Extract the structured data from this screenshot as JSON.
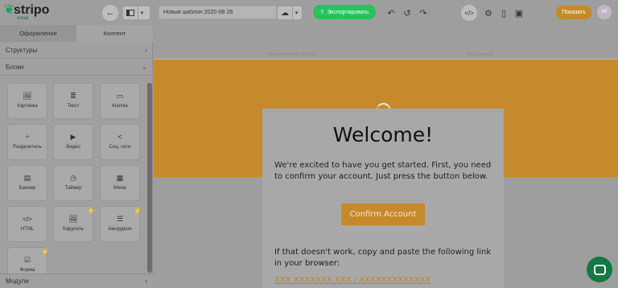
{
  "app": {
    "logo_text": "stripo",
    "logo_sub": "email"
  },
  "toolbar": {
    "back_icon": "arrow-left-icon",
    "template_name": "Новый шаблон 2020-08-26",
    "export_label": "Экспортировать",
    "show_label": "Показать",
    "avatar_initials": "AV",
    "export_color": "#22c55e",
    "show_color": "#c78a2a"
  },
  "panel": {
    "tabs": [
      {
        "label": "Оформление",
        "active": false
      },
      {
        "label": "Контент",
        "active": true
      }
    ],
    "sections": {
      "structures": "Структуры",
      "blocks": "Блоки",
      "modules": "Модули"
    },
    "blocks": [
      {
        "label": "Картинка",
        "icon": "image-icon"
      },
      {
        "label": "Текст",
        "icon": "text-icon"
      },
      {
        "label": "Кнопка",
        "icon": "button-icon"
      },
      {
        "label": "Разделитель",
        "icon": "divider-icon"
      },
      {
        "label": "Видео",
        "icon": "video-icon"
      },
      {
        "label": "Соц. сети",
        "icon": "share-icon"
      },
      {
        "label": "Баннер",
        "icon": "banner-icon"
      },
      {
        "label": "Таймер",
        "icon": "timer-icon"
      },
      {
        "label": "Меню",
        "icon": "menu-icon"
      },
      {
        "label": "HTML",
        "icon": "code-icon"
      },
      {
        "label": "Карусель",
        "icon": "carousel-icon",
        "bolt": true
      },
      {
        "label": "Аккордеон",
        "icon": "accordion-icon",
        "bolt": true
      },
      {
        "label": "Форма",
        "icon": "form-icon",
        "bolt": true
      }
    ]
  },
  "email": {
    "preheader_left": "Put your preheader text here",
    "preheader_right": "View in browser",
    "banner_color": "#c78a2a",
    "title": "Welcome!",
    "intro": "We're excited to have you get started. First, you need to confirm your account. Just press the button below.",
    "button_label": "Confirm Account",
    "fallback": "If that doesn't work, copy and paste the following link in your browser:",
    "link_text": "XXX.XXXXXXX.XXX / XXXXXXXXXXXXX"
  }
}
